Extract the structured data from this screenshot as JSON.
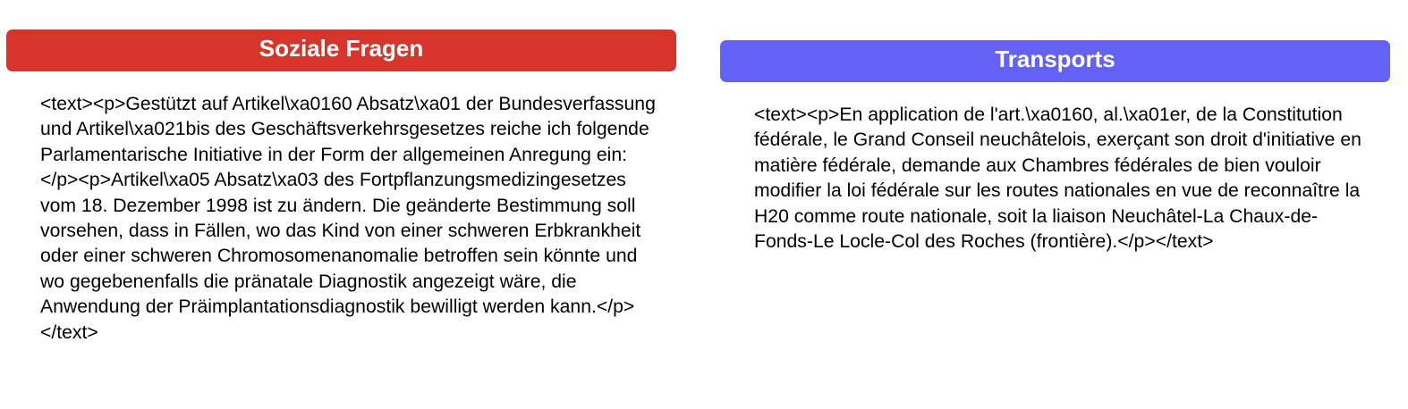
{
  "cards": [
    {
      "title": "Soziale Fragen",
      "header_color": "#d7352b",
      "text": "<text><p>Gestützt auf Artikel\\xa0160 Absatz\\xa01 der Bundesverfassung und Artikel\\xa021bis des Geschäftsverkehrsgesetzes reiche ich folgende Parlamentarische Initiative in der Form der allgemeinen Anregung ein:</p><p>Artikel\\xa05 Absatz\\xa03 des Fortpflanzungsmedizingesetzes vom 18. Dezember 1998 ist zu ändern. Die geänderte Bestimmung soll vorsehen, dass in Fällen, wo das Kind von einer schweren Erbkrankheit oder einer schweren Chromosomenanomalie betroffen sein könnte und wo gegebenenfalls die pränatale Diagnostik angezeigt wäre, die Anwendung der Präimplantationsdiagnostik bewilligt werden kann.</p></text>"
    },
    {
      "title": "Transports",
      "header_color": "#6361f6",
      "text": "<text><p>En application de l'art.\\xa0160, al.\\xa01er, de la Constitution fédérale, le Grand Conseil neuchâtelois, exerçant son droit d'initiative en matière fédérale, demande aux Chambres fédérales de bien vouloir modifier la loi fédérale sur les routes nationales en vue de reconnaître la H20 comme route nationale, soit la liaison Neuchâtel-La Chaux-de-Fonds-Le Locle-Col des Roches (frontière).</p></text>"
    }
  ]
}
